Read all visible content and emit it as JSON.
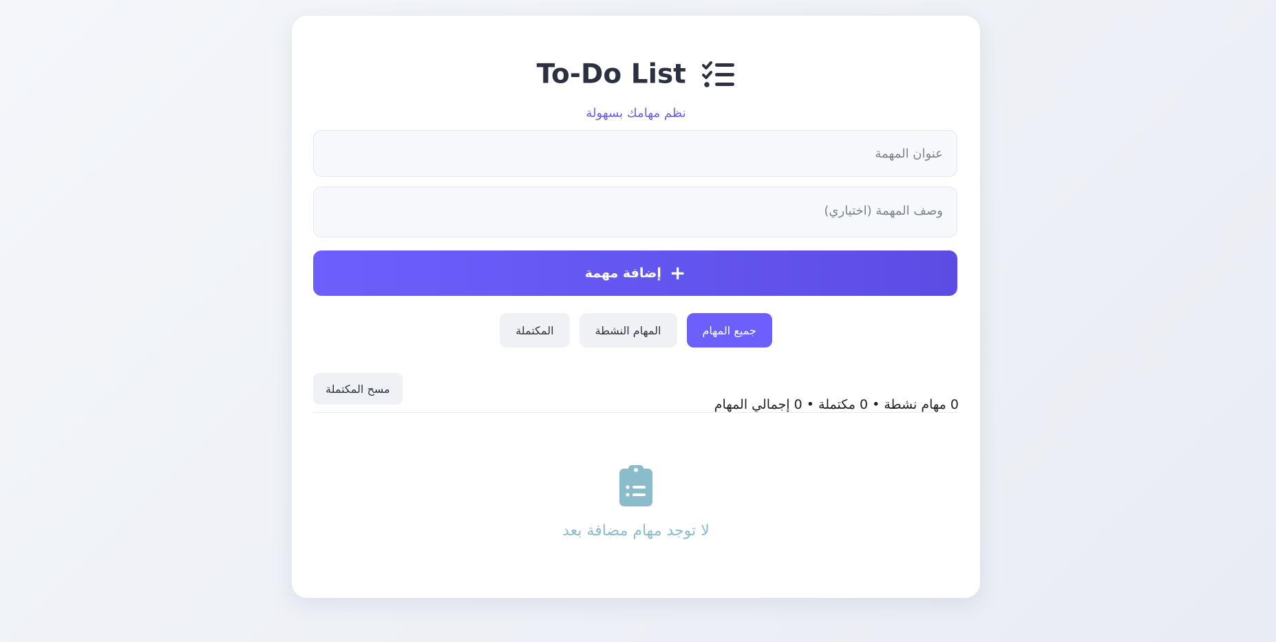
{
  "header": {
    "title": "To-Do List",
    "title_icon": "list-check-icon",
    "subtitle": "نظم مهامك بسهولة"
  },
  "form": {
    "title_placeholder": "عنوان المهمة",
    "title_value": "",
    "description_placeholder": "وصف المهمة (اختياري)",
    "description_value": "",
    "add_button_icon": "plus-icon",
    "add_button_label": "إضافة مهمة"
  },
  "filters": {
    "items": [
      {
        "label": "جميع المهام",
        "active": true
      },
      {
        "label": "المهام النشطة",
        "active": false
      },
      {
        "label": "المكتملة",
        "active": false
      }
    ]
  },
  "summary": {
    "text": "0 مهام نشطة • 0 مكتملة • 0 إجمالي المهام",
    "active_count": 0,
    "completed_count": 0,
    "total_count": 0,
    "clear_completed_label": "مسح المكتملة"
  },
  "empty_state": {
    "icon": "clipboard-list-icon",
    "message": "لا توجد مهام مضافة بعد"
  },
  "colors": {
    "accent": "#6c5ffc",
    "title_text": "#2b3140",
    "empty_state": "#8bbccc",
    "background": "#f4f6fa"
  }
}
